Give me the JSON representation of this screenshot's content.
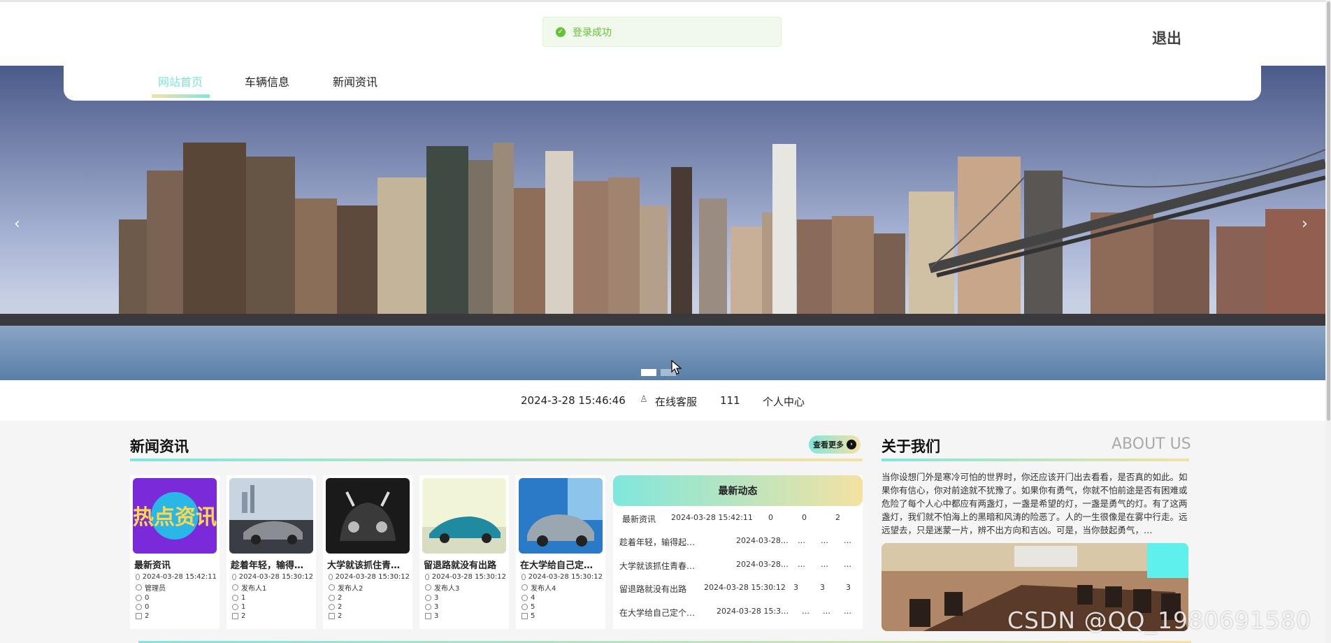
{
  "toast": {
    "message": "登录成功",
    "color": "#67c23a"
  },
  "header": {
    "logout": "退出"
  },
  "nav": {
    "items": [
      "网站首页",
      "车辆信息",
      "新闻资讯"
    ],
    "active_color": "#7fe3d6"
  },
  "carousel": {
    "prev": "‹",
    "next": "›",
    "slides": 2,
    "active_slide": 1
  },
  "infobar": {
    "datetime": "2024-3-28 15:46:46",
    "service": "在线客服",
    "user": "111",
    "center": "个人中心"
  },
  "news": {
    "title": "新闻资讯",
    "more": "查看更多",
    "cards": [
      {
        "title": "最新资讯",
        "time": "2024-03-28 15:42:11",
        "author": "管理员",
        "likes": "0",
        "favs": "0",
        "views": "2"
      },
      {
        "title": "趁着年轻，输得…",
        "time": "2024-03-28 15:30:12",
        "author": "发布人1",
        "likes": "1",
        "favs": "1",
        "views": "2"
      },
      {
        "title": "大学就该抓住青…",
        "time": "2024-03-28 15:30:12",
        "author": "发布人2",
        "likes": "2",
        "favs": "2",
        "views": "2"
      },
      {
        "title": "留退路就没有出路",
        "time": "2024-03-28 15:30:12",
        "author": "发布人3",
        "likes": "3",
        "favs": "3",
        "views": "3"
      },
      {
        "title": "在大学给自己定…",
        "time": "2024-03-28 15:30:12",
        "author": "发布人4",
        "likes": "4",
        "favs": "5",
        "views": "5"
      }
    ],
    "thumb_text": "热点资讯"
  },
  "latest": {
    "title": "最新动态",
    "rows": [
      {
        "title": "最新资讯",
        "time": "2024-03-28 15:42:11",
        "likes": "0",
        "favs": "0",
        "views": "2"
      },
      {
        "title": "趁着年轻，输得起，看…",
        "time": "2024-03-28…",
        "likes": "…",
        "favs": "…",
        "views": "…"
      },
      {
        "title": "大学就该抓住青春，用…",
        "time": "2024-03-28…",
        "likes": "…",
        "favs": "…",
        "views": "…"
      },
      {
        "title": "留退路就没有出路",
        "time": "2024-03-28 15:30:12",
        "likes": "3",
        "favs": "3",
        "views": "3"
      },
      {
        "title": "在大学给自己定个…",
        "time": "2024-03-28 15:3…",
        "likes": "…",
        "favs": "…",
        "views": "…"
      }
    ]
  },
  "about": {
    "title": "关于我们",
    "title_en": "ABOUT US",
    "text": "当你设想门外是寒冷可怕的世界时，你还应该开门出去看看，是否真的如此。如果你有信心，你对前途就不犹豫了。如果你有勇气，你就不怕前途是否有困难或危险了每个人心中都应有两盏灯，一盏是希望的灯，一盏是勇气的灯。有了这两盏灯，我们就不怕海上的黑暗和风涛的险恶了。人的一生很像是在雾中行走。远远望去，只是迷蒙一片，辨不出方向和吉凶。可是，当你鼓起勇气，…"
  },
  "watermark": "CSDN @QQ_1980691580",
  "colors": {
    "accent_teal": "#7fe7dd",
    "accent_yellow": "#f3e2a2"
  }
}
